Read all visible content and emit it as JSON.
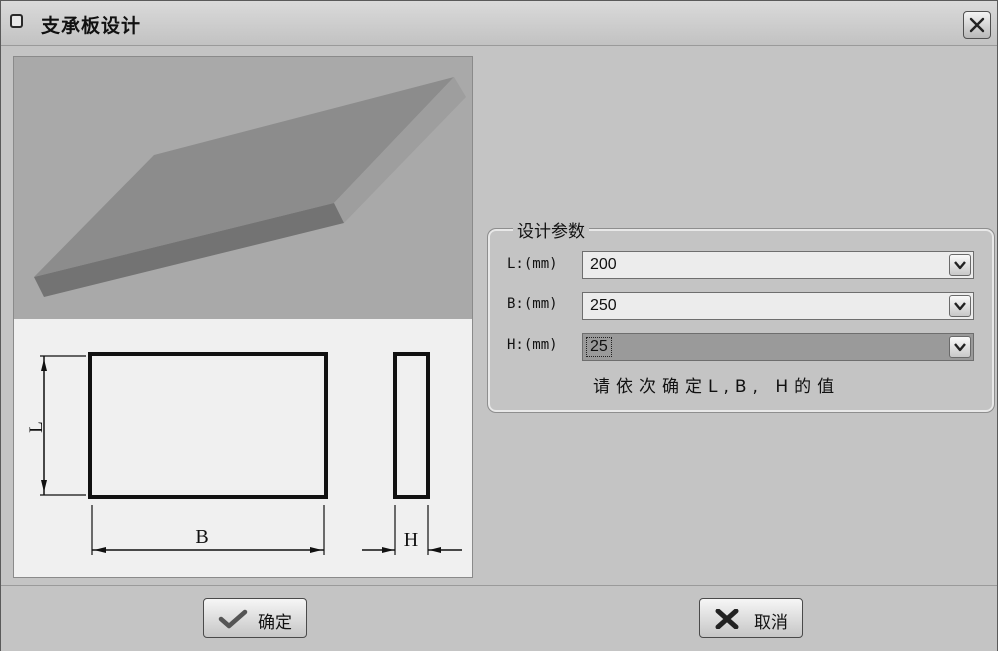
{
  "window": {
    "title": "支承板设计"
  },
  "drawing": {
    "label_l": "L",
    "label_b": "B",
    "label_h": "H"
  },
  "params": {
    "group_title": "设计参数",
    "fields": [
      {
        "label": "L:(mm)",
        "value": "200"
      },
      {
        "label": "B:(mm)",
        "value": "250"
      },
      {
        "label": "H:(mm)",
        "value": "25",
        "focused": true
      }
    ],
    "hint": "请依次确定L,B, H的值"
  },
  "buttons": {
    "ok_label": "确定",
    "cancel_label": "取消"
  }
}
